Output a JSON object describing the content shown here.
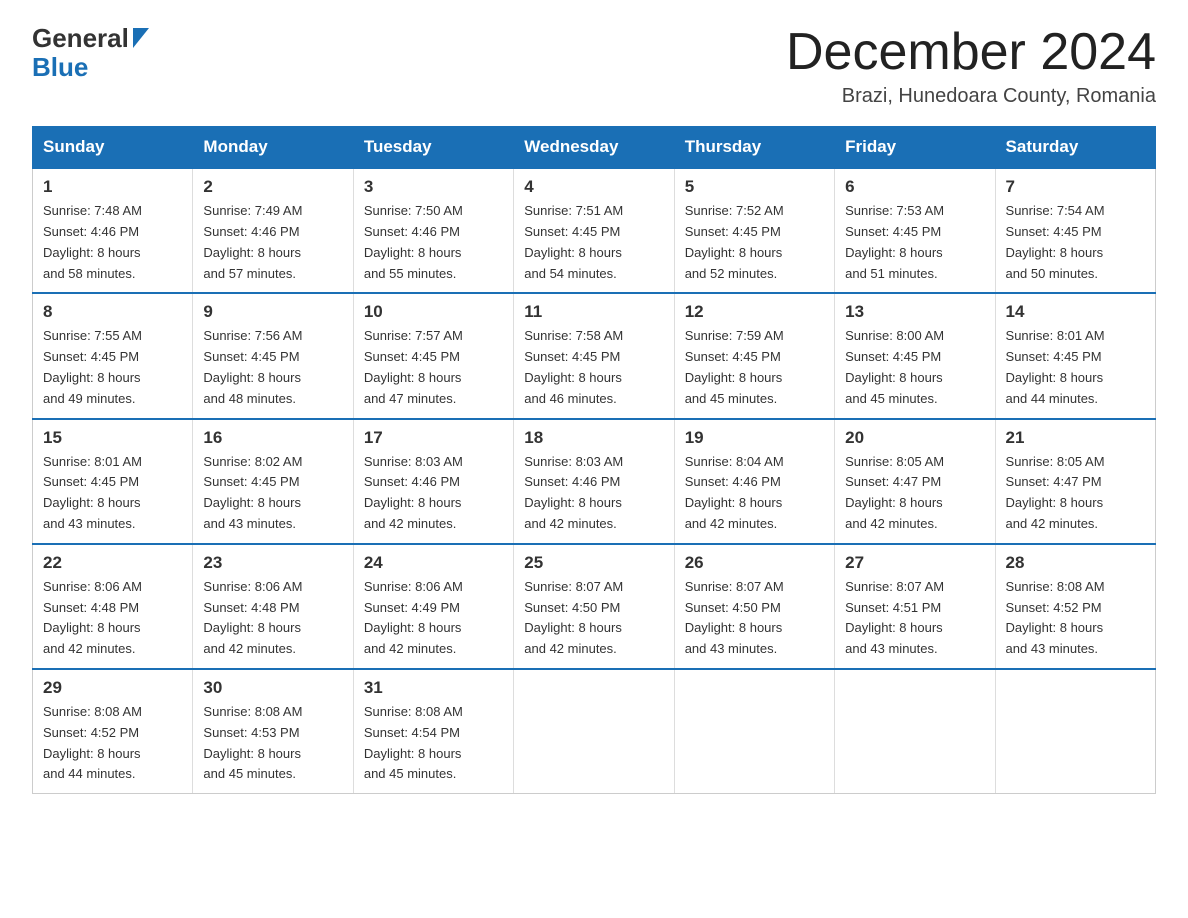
{
  "header": {
    "logo_line1": "General",
    "logo_line2": "Blue",
    "title": "December 2024",
    "location": "Brazi, Hunedoara County, Romania"
  },
  "weekdays": [
    "Sunday",
    "Monday",
    "Tuesday",
    "Wednesday",
    "Thursday",
    "Friday",
    "Saturday"
  ],
  "weeks": [
    [
      {
        "day": "1",
        "sunrise": "7:48 AM",
        "sunset": "4:46 PM",
        "daylight": "8 hours and 58 minutes."
      },
      {
        "day": "2",
        "sunrise": "7:49 AM",
        "sunset": "4:46 PM",
        "daylight": "8 hours and 57 minutes."
      },
      {
        "day": "3",
        "sunrise": "7:50 AM",
        "sunset": "4:46 PM",
        "daylight": "8 hours and 55 minutes."
      },
      {
        "day": "4",
        "sunrise": "7:51 AM",
        "sunset": "4:45 PM",
        "daylight": "8 hours and 54 minutes."
      },
      {
        "day": "5",
        "sunrise": "7:52 AM",
        "sunset": "4:45 PM",
        "daylight": "8 hours and 52 minutes."
      },
      {
        "day": "6",
        "sunrise": "7:53 AM",
        "sunset": "4:45 PM",
        "daylight": "8 hours and 51 minutes."
      },
      {
        "day": "7",
        "sunrise": "7:54 AM",
        "sunset": "4:45 PM",
        "daylight": "8 hours and 50 minutes."
      }
    ],
    [
      {
        "day": "8",
        "sunrise": "7:55 AM",
        "sunset": "4:45 PM",
        "daylight": "8 hours and 49 minutes."
      },
      {
        "day": "9",
        "sunrise": "7:56 AM",
        "sunset": "4:45 PM",
        "daylight": "8 hours and 48 minutes."
      },
      {
        "day": "10",
        "sunrise": "7:57 AM",
        "sunset": "4:45 PM",
        "daylight": "8 hours and 47 minutes."
      },
      {
        "day": "11",
        "sunrise": "7:58 AM",
        "sunset": "4:45 PM",
        "daylight": "8 hours and 46 minutes."
      },
      {
        "day": "12",
        "sunrise": "7:59 AM",
        "sunset": "4:45 PM",
        "daylight": "8 hours and 45 minutes."
      },
      {
        "day": "13",
        "sunrise": "8:00 AM",
        "sunset": "4:45 PM",
        "daylight": "8 hours and 45 minutes."
      },
      {
        "day": "14",
        "sunrise": "8:01 AM",
        "sunset": "4:45 PM",
        "daylight": "8 hours and 44 minutes."
      }
    ],
    [
      {
        "day": "15",
        "sunrise": "8:01 AM",
        "sunset": "4:45 PM",
        "daylight": "8 hours and 43 minutes."
      },
      {
        "day": "16",
        "sunrise": "8:02 AM",
        "sunset": "4:45 PM",
        "daylight": "8 hours and 43 minutes."
      },
      {
        "day": "17",
        "sunrise": "8:03 AM",
        "sunset": "4:46 PM",
        "daylight": "8 hours and 42 minutes."
      },
      {
        "day": "18",
        "sunrise": "8:03 AM",
        "sunset": "4:46 PM",
        "daylight": "8 hours and 42 minutes."
      },
      {
        "day": "19",
        "sunrise": "8:04 AM",
        "sunset": "4:46 PM",
        "daylight": "8 hours and 42 minutes."
      },
      {
        "day": "20",
        "sunrise": "8:05 AM",
        "sunset": "4:47 PM",
        "daylight": "8 hours and 42 minutes."
      },
      {
        "day": "21",
        "sunrise": "8:05 AM",
        "sunset": "4:47 PM",
        "daylight": "8 hours and 42 minutes."
      }
    ],
    [
      {
        "day": "22",
        "sunrise": "8:06 AM",
        "sunset": "4:48 PM",
        "daylight": "8 hours and 42 minutes."
      },
      {
        "day": "23",
        "sunrise": "8:06 AM",
        "sunset": "4:48 PM",
        "daylight": "8 hours and 42 minutes."
      },
      {
        "day": "24",
        "sunrise": "8:06 AM",
        "sunset": "4:49 PM",
        "daylight": "8 hours and 42 minutes."
      },
      {
        "day": "25",
        "sunrise": "8:07 AM",
        "sunset": "4:50 PM",
        "daylight": "8 hours and 42 minutes."
      },
      {
        "day": "26",
        "sunrise": "8:07 AM",
        "sunset": "4:50 PM",
        "daylight": "8 hours and 43 minutes."
      },
      {
        "day": "27",
        "sunrise": "8:07 AM",
        "sunset": "4:51 PM",
        "daylight": "8 hours and 43 minutes."
      },
      {
        "day": "28",
        "sunrise": "8:08 AM",
        "sunset": "4:52 PM",
        "daylight": "8 hours and 43 minutes."
      }
    ],
    [
      {
        "day": "29",
        "sunrise": "8:08 AM",
        "sunset": "4:52 PM",
        "daylight": "8 hours and 44 minutes."
      },
      {
        "day": "30",
        "sunrise": "8:08 AM",
        "sunset": "4:53 PM",
        "daylight": "8 hours and 45 minutes."
      },
      {
        "day": "31",
        "sunrise": "8:08 AM",
        "sunset": "4:54 PM",
        "daylight": "8 hours and 45 minutes."
      },
      null,
      null,
      null,
      null
    ]
  ]
}
